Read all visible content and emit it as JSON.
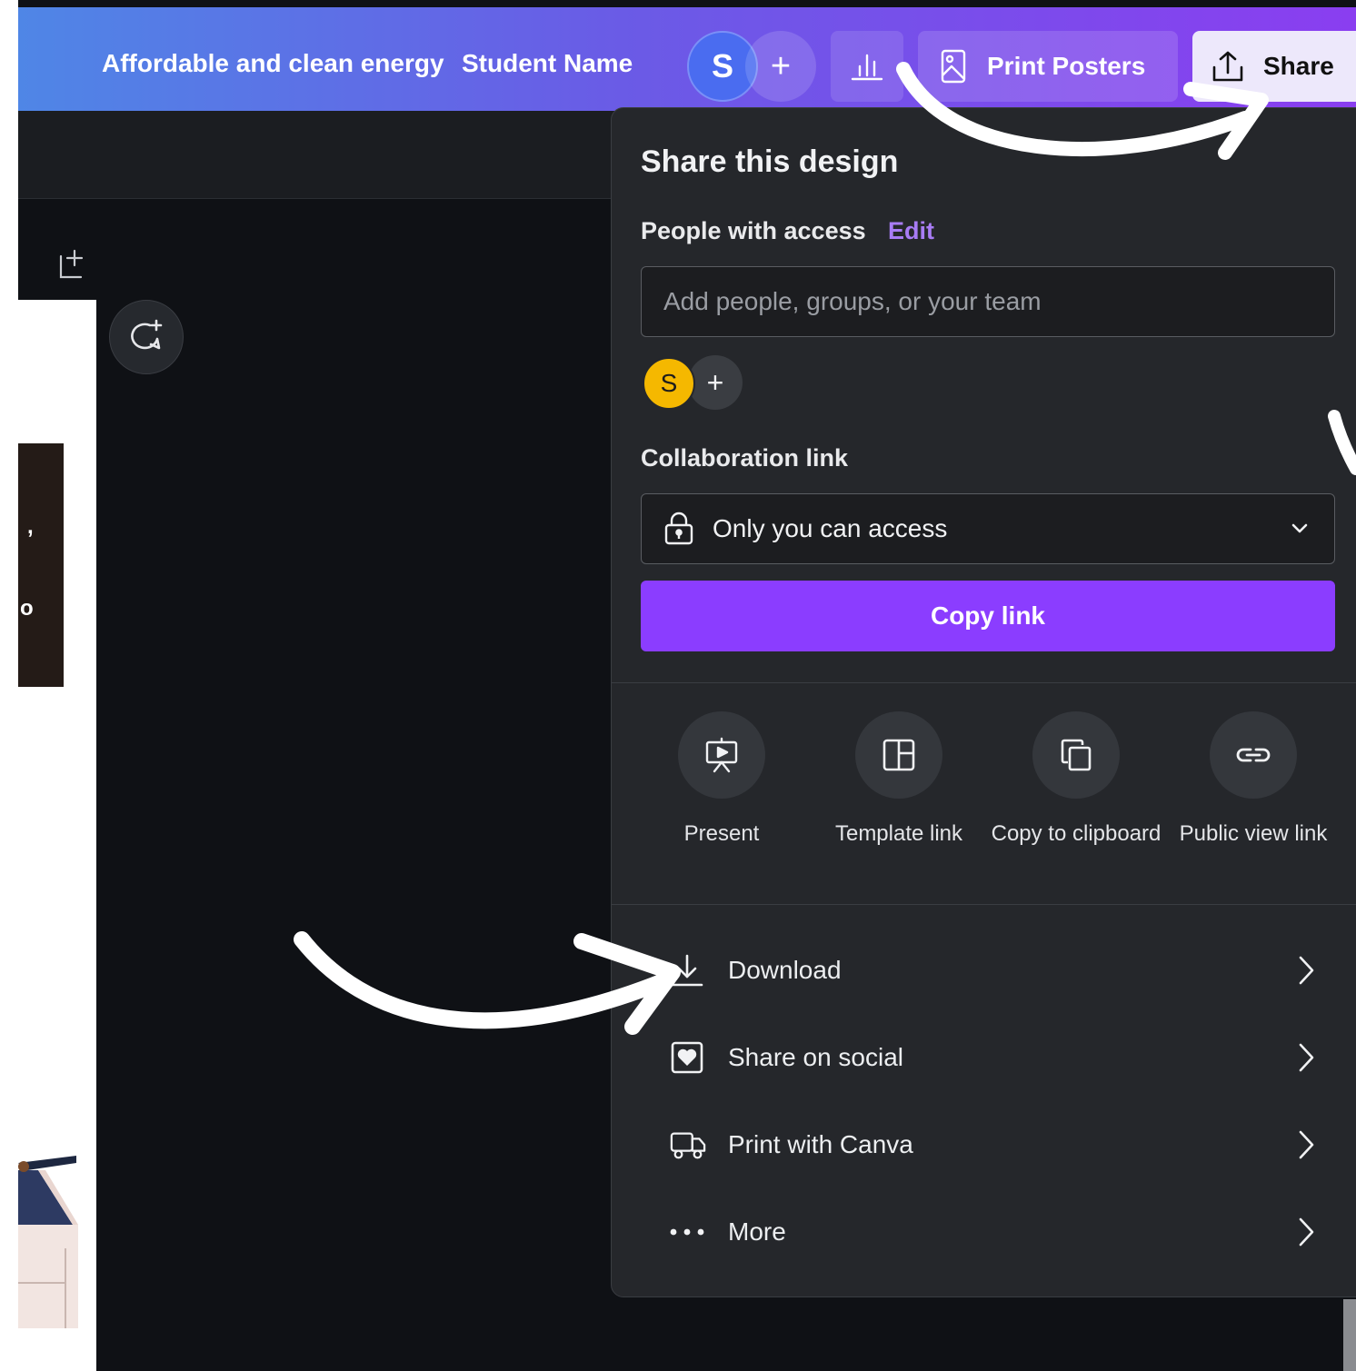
{
  "topbar": {
    "doc_title": "Affordable and clean energy",
    "student_name": "Student Name",
    "avatar_initial": "S",
    "add_collaborator": "+",
    "print_label": "Print Posters",
    "share_label": "Share"
  },
  "page_preview": {
    "char1": ",",
    "char2": "o"
  },
  "share_panel": {
    "title": "Share this design",
    "people_label": "People with access",
    "edit_label": "Edit",
    "add_people_placeholder": "Add people, groups, or your team",
    "avatar_initial": "S",
    "avatar_add": "+",
    "collab_label": "Collaboration link",
    "collab_value": "Only you can access",
    "copy_link_label": "Copy link",
    "quick_actions": [
      {
        "label": "Present",
        "icon": "present-icon"
      },
      {
        "label": "Template link",
        "icon": "template-icon"
      },
      {
        "label": "Copy to clipboard",
        "icon": "copy-icon"
      },
      {
        "label": "Public view link",
        "icon": "link-icon"
      }
    ],
    "rows": [
      {
        "label": "Download",
        "icon": "download-icon"
      },
      {
        "label": "Share on social",
        "icon": "heart-icon"
      },
      {
        "label": "Print with Canva",
        "icon": "truck-icon"
      },
      {
        "label": "More",
        "icon": "more-icon"
      }
    ]
  },
  "colors": {
    "accent": "#8b3dff",
    "panel_bg": "#25272b",
    "canvas_bg": "#0f1115",
    "edit_link": "#a87cf5",
    "avatar_yellow": "#f5b800"
  }
}
